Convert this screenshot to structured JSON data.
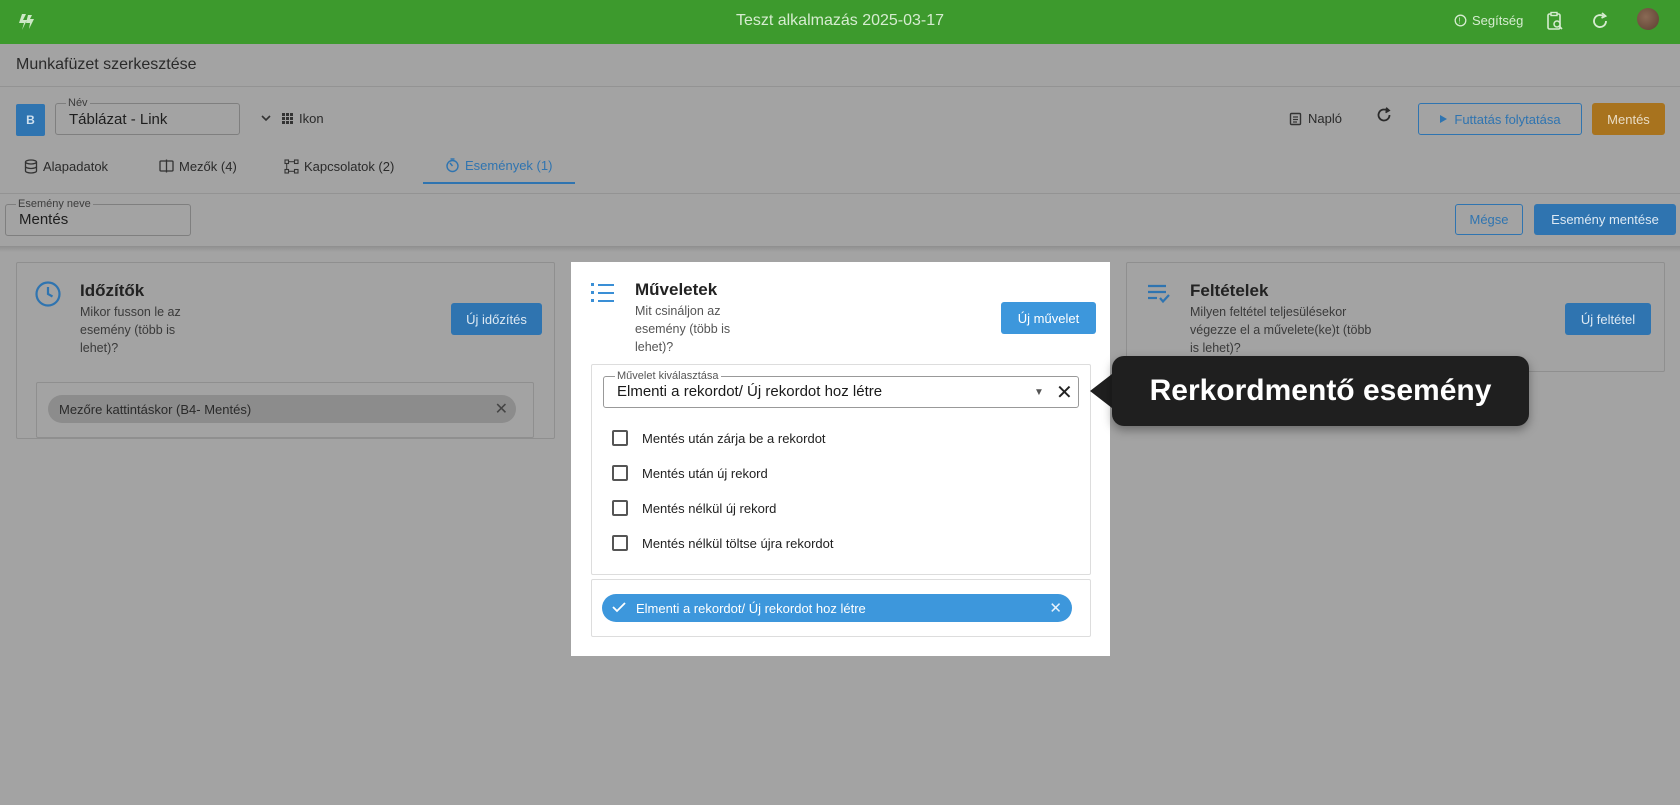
{
  "topbar": {
    "app_title": "Teszt alkalmazás 2025-03-17",
    "help_label": "Segítség",
    "icons": [
      "logo-icon",
      "help-icon",
      "clipboard-search-icon",
      "refresh-icon",
      "avatar"
    ]
  },
  "page": {
    "title": "Munkafüzet szerkesztése",
    "badge": "B",
    "name_field": {
      "label": "Név",
      "value": "Táblázat - Link"
    },
    "icon_button": "Ikon",
    "log_button": "Napló",
    "continue_button": "Futtatás folytatása",
    "save_button": "Mentés"
  },
  "tabs": [
    {
      "label": "Alapadatok",
      "icon": "database-icon"
    },
    {
      "label": "Mezők (4)",
      "icon": "field-icon"
    },
    {
      "label": "Kapcsolatok (2)",
      "icon": "connections-icon"
    },
    {
      "label": "Események (1)",
      "icon": "events-icon",
      "active": true
    }
  ],
  "event_bar": {
    "name_label": "Esemény neve",
    "name_value": "Mentés",
    "cancel_button": "Mégse",
    "save_event_button": "Esemény mentése"
  },
  "timers": {
    "title": "Időzítők",
    "description": "Mikor fusson le az esemény (több is lehet)?",
    "new_button": "Új időzítés",
    "items": [
      "Mezőre kattintáskor (B4- Mentés)"
    ]
  },
  "actions": {
    "title": "Műveletek",
    "description": "Mit csináljon az esemény (több is lehet)?",
    "new_button": "Új művelet",
    "select_label": "Művelet kiválasztása",
    "select_value": "Elmenti a rekordot/ Új rekordot hoz létre",
    "options": [
      "Mentés után zárja be a rekordot",
      "Mentés után új rekord",
      "Mentés nélkül új rekord",
      "Mentés nélkül töltse újra rekordot"
    ],
    "selected_chip": "Elmenti a rekordot/ Új rekordot hoz létre"
  },
  "conditions": {
    "title": "Feltételek",
    "description": "Milyen feltétel teljesülésekor végezze el a művelete(ke)t (több is lehet)?",
    "new_button": "Új feltétel"
  },
  "tooltip": {
    "text": "Rerkordmentő esemény"
  }
}
